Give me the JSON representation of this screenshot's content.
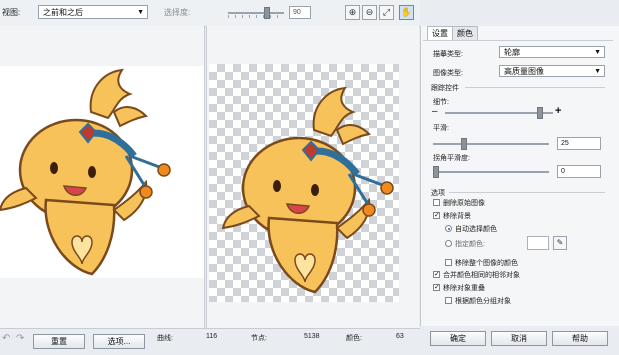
{
  "toolbar": {
    "mode_label": "视图:",
    "mode_value": "之前和之后",
    "smooth_label": "选择度:",
    "zoom_value": "90",
    "tools": [
      {
        "icon": "zoom-in-icon",
        "glyph": "⊕"
      },
      {
        "icon": "zoom-out-icon",
        "glyph": "⊖"
      },
      {
        "icon": "fit-to-window-icon",
        "glyph": "⤢"
      },
      {
        "icon": "pan-hand-icon",
        "glyph": "✋"
      }
    ]
  },
  "panel": {
    "tabs": [
      "设置",
      "颜色"
    ],
    "trace_type_label": "描摹类型:",
    "trace_type_value": "轮廓",
    "image_type_label": "图像类型:",
    "image_type_value": "高质量图像",
    "trace_controls_title": "跟踪控件",
    "detail_label": "细节:",
    "smoothing_label": "平滑:",
    "smoothing_value": "25",
    "corner_label": "拐角平滑度:",
    "corner_value": "0",
    "options_title": "选项",
    "delete_original_label": "删除原始图像",
    "delete_original_checked": false,
    "remove_bg_label": "移除背景",
    "remove_bg_checked": true,
    "auto_color_label": "自动选择颜色",
    "auto_color_selected": true,
    "specify_color_label": "指定颜色:",
    "specify_color_selected": false,
    "remove_whole_label": "移除整个图像的颜色",
    "remove_whole_checked": false,
    "merge_adjacent_label": "合并颜色相同的相邻对象",
    "merge_adjacent_checked": true,
    "remove_overlap_label": "移除对象重叠",
    "remove_overlap_checked": true,
    "group_by_color_label": "根据颜色分组对象",
    "group_by_color_checked": false
  },
  "bottom": {
    "reset_label": "重置",
    "options_label": "选项...",
    "curves_label": "曲线:",
    "curves_value": "116",
    "nodes_label": "节点:",
    "nodes_value": "5138",
    "colors_label": "颜色:",
    "colors_value": "63",
    "ok_label": "确定",
    "cancel_label": "取消",
    "help_label": "帮助"
  },
  "colors": {
    "character_body": "#f7c25a",
    "character_outline": "#7a4a1c",
    "headband": "#2f6f9a",
    "accent_ball": "#f08a1e",
    "checker_grey": "#cfd2d6",
    "active_tool": "#cfe3f7"
  }
}
